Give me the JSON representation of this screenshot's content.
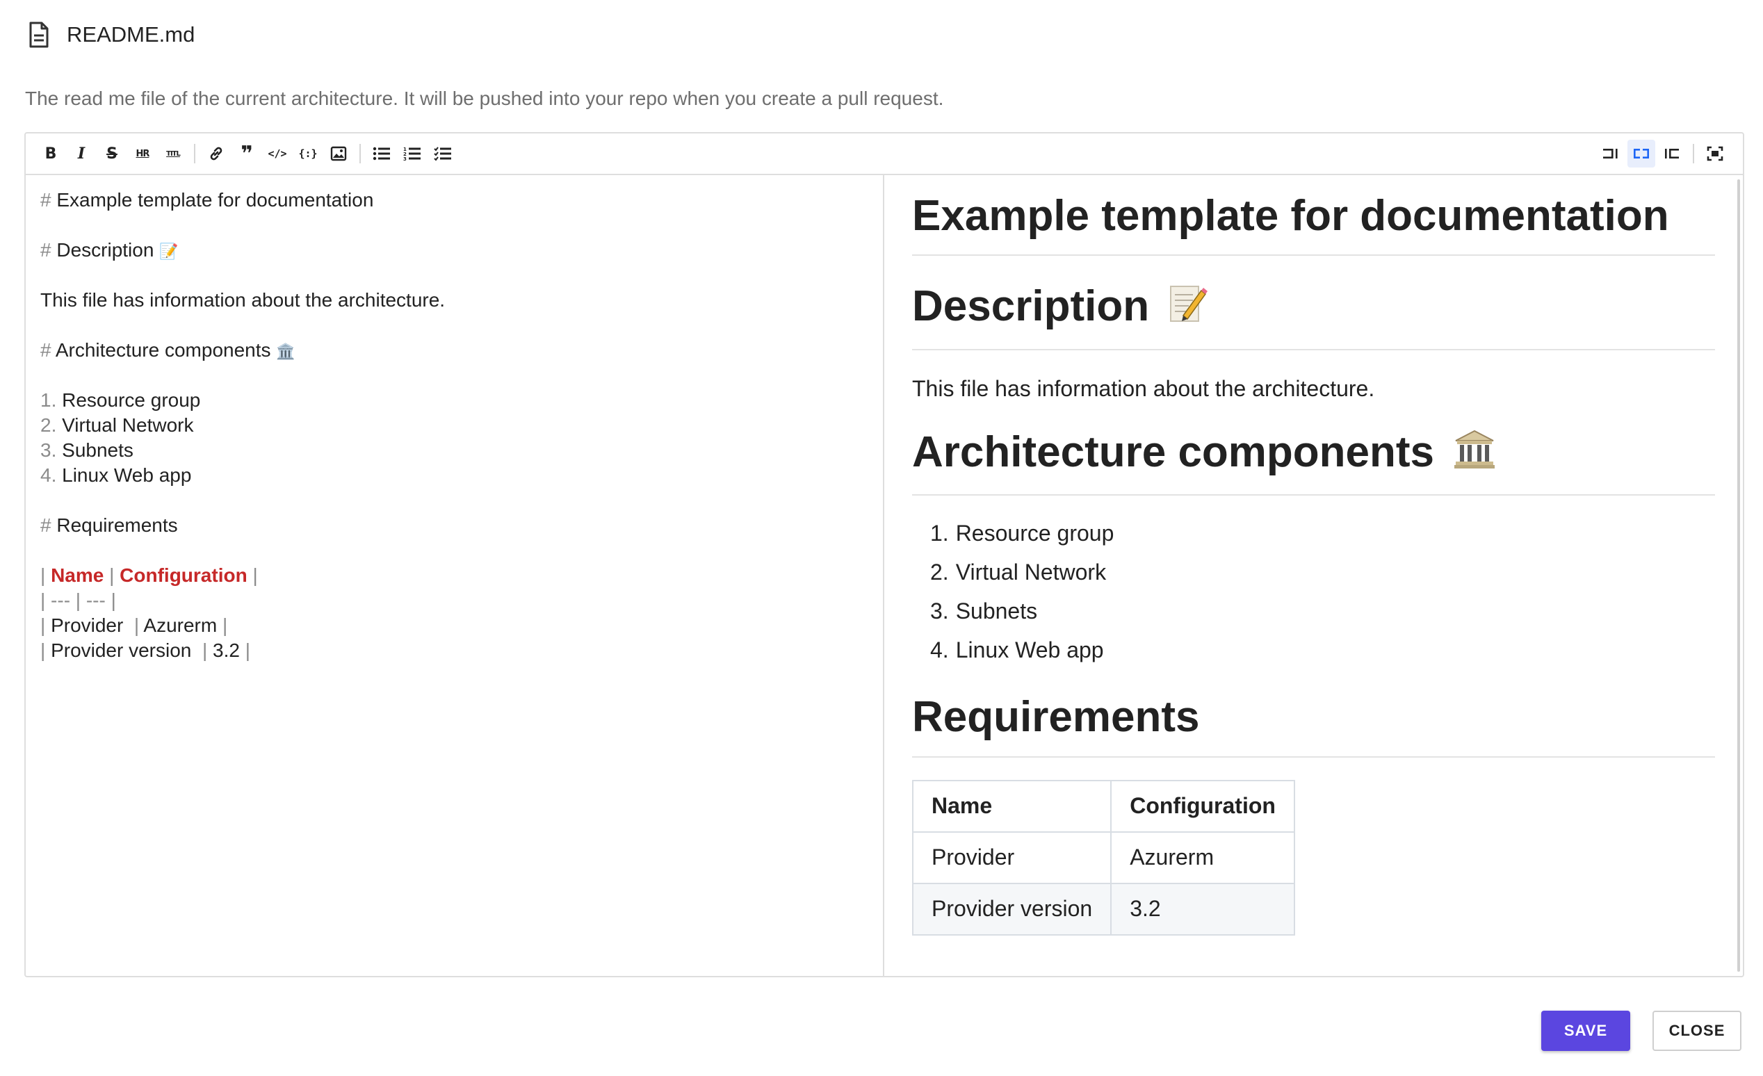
{
  "header": {
    "file_name": "README.md",
    "description": "The read me file of the current architecture. It will be pushed into your repo when you create a pull request."
  },
  "toolbar": {
    "left_tools": [
      "bold-icon",
      "italic-icon",
      "strikethrough-icon",
      "horizontal-rule-icon",
      "title-icon",
      "link-icon",
      "quote-icon",
      "code-icon",
      "code-block-icon",
      "image-icon",
      "unordered-list-icon",
      "ordered-list-icon",
      "checklist-icon"
    ],
    "right_tools": [
      "edit-mode-icon",
      "split-mode-icon",
      "preview-mode-icon",
      "fullscreen-icon"
    ],
    "labels": {
      "bold": "B",
      "italic": "I",
      "strike": "S",
      "hr": "HR",
      "title": "TITL",
      "quote": "❞",
      "code": "</>",
      "codeblock": "{:}"
    },
    "active_mode": "split"
  },
  "source": {
    "h1_marker": "#",
    "heading1": "Example template for documentation",
    "heading2": "Description",
    "heading2_emoji": "📝",
    "paragraph": "This file has information about the architecture.",
    "heading3": "Architecture components",
    "heading3_emoji": "🏛️",
    "list": [
      {
        "num": "1.",
        "text": "Resource group"
      },
      {
        "num": "2.",
        "text": "Virtual Network"
      },
      {
        "num": "3.",
        "text": "Subnets"
      },
      {
        "num": "4.",
        "text": "Linux Web app"
      }
    ],
    "heading4": "Requirements",
    "pipe": "|",
    "table_header": [
      "Name",
      "Configuration"
    ],
    "table_separator": "| --- | --- |",
    "table_rows": [
      [
        "Provider ",
        "Azurerm"
      ],
      [
        "Provider version ",
        "3.2"
      ]
    ]
  },
  "preview": {
    "h1": "Example template for documentation",
    "h2": "Description",
    "paragraph": "This file has information about the architecture.",
    "h3": "Architecture components",
    "list": [
      "Resource group",
      "Virtual Network",
      "Subnets",
      "Linux Web app"
    ],
    "list_nums": [
      "1.",
      "2.",
      "3.",
      "4."
    ],
    "h4": "Requirements",
    "table": {
      "headers": [
        "Name",
        "Configuration"
      ],
      "rows": [
        [
          "Provider",
          "Azurerm"
        ],
        [
          "Provider version",
          "3.2"
        ]
      ]
    }
  },
  "actions": {
    "save": "SAVE",
    "close": "CLOSE"
  },
  "colors": {
    "accent": "#5b46e0",
    "markdown_strong": "#c62828",
    "active_mode": "#1e66f5"
  }
}
